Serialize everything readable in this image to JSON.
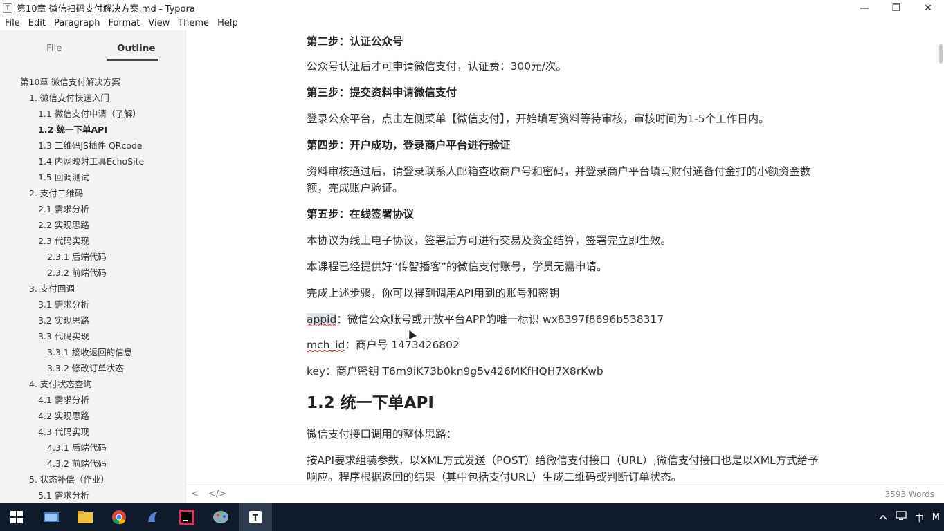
{
  "window": {
    "title": "第10章 微信扫码支付解决方案.md - Typora",
    "app_icon": "T",
    "minimize": "—",
    "restore": "❐",
    "close": "✕"
  },
  "menu": [
    "File",
    "Edit",
    "Paragraph",
    "Format",
    "View",
    "Theme",
    "Help"
  ],
  "sidebar": {
    "tabs": [
      "File",
      "Outline"
    ],
    "outline": [
      {
        "label": "第10章 微信支付解决方案",
        "level": 0
      },
      {
        "label": "1. 微信支付快速入门",
        "level": 1
      },
      {
        "label": "1.1 微信支付申请（了解）",
        "level": 2
      },
      {
        "label": "1.2 统一下单API",
        "level": 2,
        "active": true
      },
      {
        "label": "1.3 二维码JS插件 QRcode",
        "level": 2
      },
      {
        "label": "1.4 内网映射工具EchoSite",
        "level": 2
      },
      {
        "label": "1.5 回调测试",
        "level": 2
      },
      {
        "label": "2. 支付二维码",
        "level": 1
      },
      {
        "label": "2.1 需求分析",
        "level": 2
      },
      {
        "label": "2.2 实现思路",
        "level": 2
      },
      {
        "label": "2.3 代码实现",
        "level": 2
      },
      {
        "label": "2.3.1 后端代码",
        "level": 3
      },
      {
        "label": "2.3.2 前端代码",
        "level": 3
      },
      {
        "label": "3. 支付回调",
        "level": 1
      },
      {
        "label": "3.1 需求分析",
        "level": 2
      },
      {
        "label": "3.2 实现思路",
        "level": 2
      },
      {
        "label": "3.3 代码实现",
        "level": 2
      },
      {
        "label": "3.3.1 接收返回的信息",
        "level": 3
      },
      {
        "label": "3.3.2 修改订单状态",
        "level": 3
      },
      {
        "label": "4. 支付状态查询",
        "level": 1
      },
      {
        "label": "4.1 需求分析",
        "level": 2
      },
      {
        "label": "4.2 实现思路",
        "level": 2
      },
      {
        "label": "4.3 代码实现",
        "level": 2
      },
      {
        "label": "4.3.1 后端代码",
        "level": 3
      },
      {
        "label": "4.3.2 前端代码",
        "level": 3
      },
      {
        "label": "5. 状态补偿（作业）",
        "level": 1
      },
      {
        "label": "5.1 需求分析",
        "level": 2
      }
    ]
  },
  "document": {
    "step2_heading": "第二步：认证公众号",
    "step2_text": "公众号认证后才可申请微信支付，认证费：300元/次。",
    "step3_heading": "第三步：提交资料申请微信支付",
    "step3_text": "登录公众平台，点击左侧菜单【微信支付】，开始填写资料等待审核，审核时间为1-5个工作日内。",
    "step4_heading": "第四步：开户成功，登录商户平台进行验证",
    "step4_text": "资料审核通过后，请登录联系人邮箱查收商户号和密码，并登录商户平台填写财付通备付金打的小额资金数额，完成账户验证。",
    "step5_heading": "第五步：在线签署协议",
    "step5_text": "本协议为线上电子协议，签署后方可进行交易及资金结算，签署完立即生效。",
    "course_note": "本课程已经提供好“传智播客”的微信支付账号，学员无需申请。",
    "done_note": "完成上述步骤，你可以得到调用API用到的账号和密钥",
    "appid_key": "appid",
    "appid_text": "：微信公众账号或开放平台APP的唯一标识  wx8397f8696b538317",
    "mchid_key": "mch_id",
    "mchid_text": "：商户号  1473426802",
    "key_text": "key：商户密钥   T6m9iK73b0kn9g5v426MKfHQH7X8rKwb",
    "section_heading": "1.2 统一下单API",
    "idea_text": "微信支付接口调用的整体思路：",
    "flow_text": "按API要求组装参数，以XML方式发送（POST）给微信支付接口（URL）,微信支付接口也是以XML方式给予响应。程序根据返回的结果（其中包括支付URL）生成二维码或判断订单状态。"
  },
  "status": {
    "back_icon": "<",
    "source_icon": "</>",
    "word_count": "3593 Words"
  },
  "tray": {
    "ime": "中",
    "ime2": "M"
  }
}
